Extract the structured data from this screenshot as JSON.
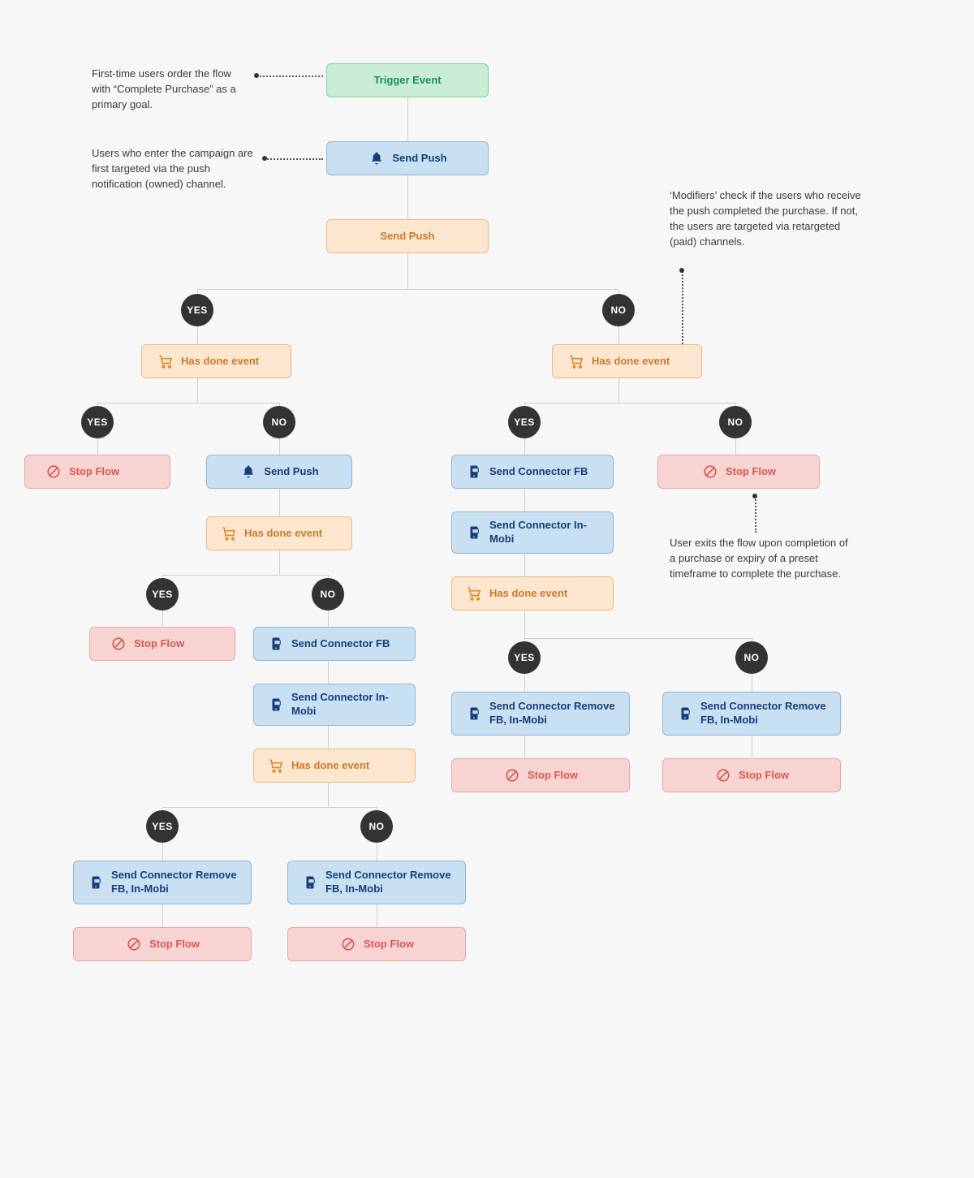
{
  "annotations": {
    "a1": "First-time users order the flow with “Complete Purchase” as a primary goal.",
    "a2": "Users who enter the campaign are first targeted via the push notification (owned) channel.",
    "a3": "‘Modifiers’ check if the users who receive the push completed the purchase. If not, the users are targeted via retargeted (paid) channels.",
    "a4": "User exits the flow upon completion of a purchase or expiry of a preset timeframe to complete the purchase."
  },
  "labels": {
    "trigger": "Trigger Event",
    "sendPush": "Send Push",
    "hasDone": "Has done event",
    "stopFlow": "Stop Flow",
    "sendFB": "Send Connector FB",
    "sendInMobi": "Send Connector In-Mobi",
    "removeFBInMobi": "Send Connector Remove FB, In-Mobi",
    "yes": "YES",
    "no": "NO"
  },
  "colors": {
    "green": "#c9ecd5",
    "blue": "#c9dff2",
    "orange": "#fce6cf",
    "red": "#f7d4d2",
    "badge": "#333333"
  }
}
